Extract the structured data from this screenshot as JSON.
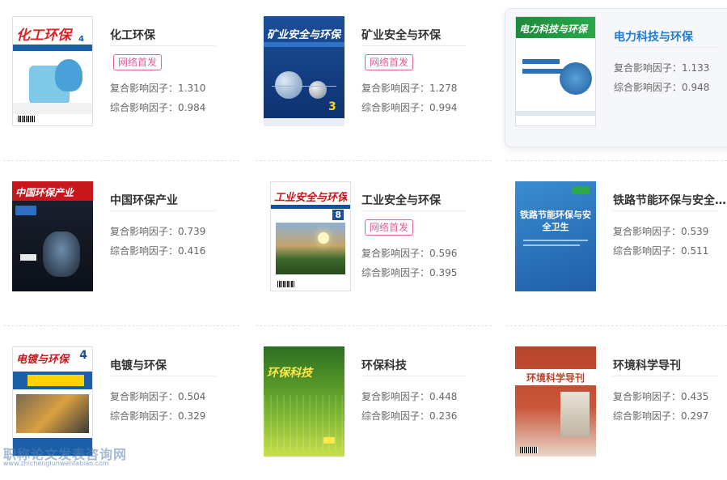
{
  "journals": [
    {
      "title": "化工环保",
      "badge": "网络首发",
      "stat1": "复合影响因子：1.310",
      "stat2": "综合影响因子：0.984",
      "cover": {
        "name": "化工环保",
        "text": "化工环保",
        "num": "4"
      }
    },
    {
      "title": "矿业安全与环保",
      "badge": "网络首发",
      "stat1": "复合影响因子：1.278",
      "stat2": "综合影响因子：0.994",
      "cover": {
        "name": "矿业安全与环保",
        "text": "矿业安全与环保",
        "num": "3"
      }
    },
    {
      "title": "电力科技与环保",
      "badge": "",
      "stat1": "复合影响因子：1.133",
      "stat2": "综合影响因子：0.948",
      "cover": {
        "name": "电力科技与环保",
        "text": "电力科技与环保",
        "num": ""
      }
    },
    {
      "title": "中国环保产业",
      "badge": "",
      "stat1": "复合影响因子：0.739",
      "stat2": "综合影响因子：0.416",
      "cover": {
        "name": "中国环保产业",
        "text": "中国环保产业",
        "num": ""
      }
    },
    {
      "title": "工业安全与环保",
      "badge": "网络首发",
      "stat1": "复合影响因子：0.596",
      "stat2": "综合影响因子：0.395",
      "cover": {
        "name": "工业安全与环保",
        "text": "工业安全与环保",
        "num": "8"
      }
    },
    {
      "title": "铁路节能环保与安全卫生",
      "badge": "",
      "stat1": "复合影响因子：0.539",
      "stat2": "综合影响因子：0.511",
      "cover": {
        "name": "铁路节能环保与安全卫生",
        "text": "铁路节能环保与安全卫生",
        "num": ""
      }
    },
    {
      "title": "电镀与环保",
      "badge": "",
      "stat1": "复合影响因子：0.504",
      "stat2": "综合影响因子：0.329",
      "cover": {
        "name": "电镀与环保",
        "text": "电镀与环保",
        "num": "4"
      }
    },
    {
      "title": "环保科技",
      "badge": "",
      "stat1": "复合影响因子：0.448",
      "stat2": "综合影响因子：0.236",
      "cover": {
        "name": "环保科技",
        "text": "环保科技",
        "num": ""
      }
    },
    {
      "title": "环境科学导刊",
      "badge": "",
      "stat1": "复合影响因子：0.435",
      "stat2": "综合影响因子：0.297",
      "cover": {
        "name": "环境科学导刊",
        "text": "环境科学导刊",
        "num": ""
      }
    }
  ],
  "watermark": {
    "text": "职称论文发表咨询网",
    "url": "www.zhichenglunwenfabiao.com"
  },
  "colors": {
    "badge": "#e0609a",
    "highlight_title": "#1f7bd8"
  }
}
